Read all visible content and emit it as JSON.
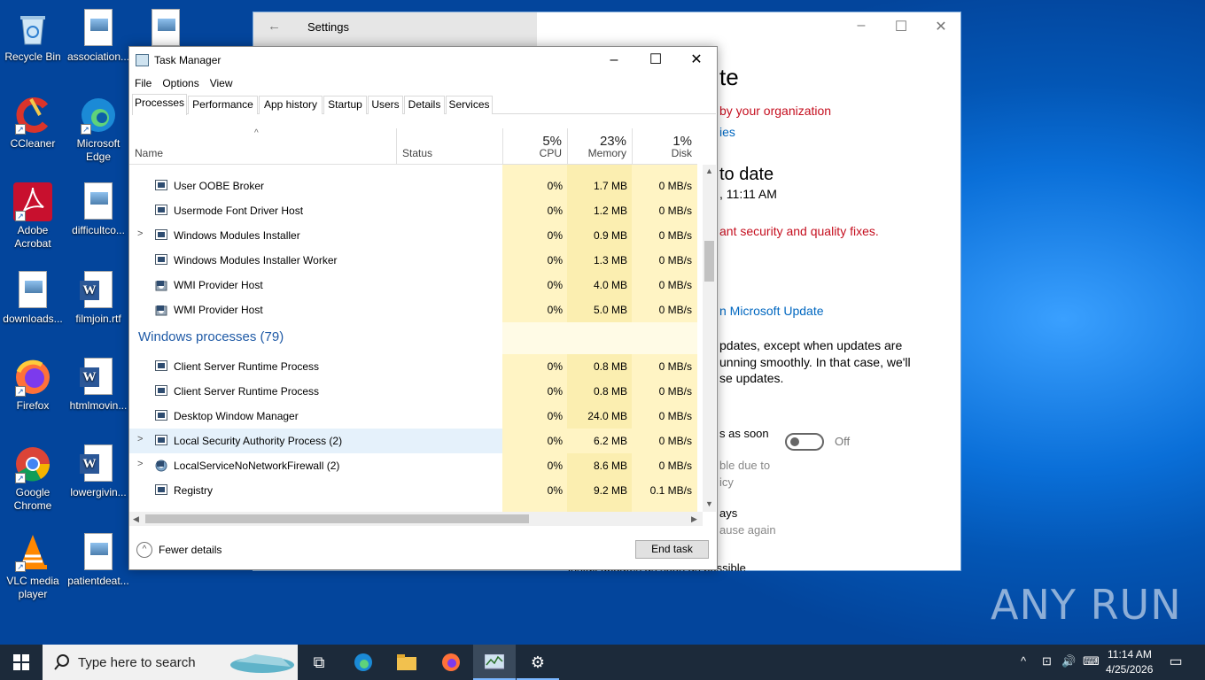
{
  "desktop": {
    "icons": [
      {
        "label": "Recycle Bin"
      },
      {
        "label": "association..."
      },
      {
        "label": "CCleaner"
      },
      {
        "label": "Microsoft Edge"
      },
      {
        "label": "Adobe Acrobat"
      },
      {
        "label": "difficultco..."
      },
      {
        "label": "downloads..."
      },
      {
        "label": "filmjoin.rtf"
      },
      {
        "label": "Firefox"
      },
      {
        "label": "htmlmovin..."
      },
      {
        "label": "Google Chrome"
      },
      {
        "label": "lowergivin..."
      },
      {
        "label": "VLC media player"
      },
      {
        "label": "patientdeat..."
      }
    ]
  },
  "settings": {
    "title": "Settings",
    "heading": "te",
    "org_notice": "by your organization",
    "policies_link": "ies",
    "status_heading": "to date",
    "last_checked": ", 11:11 AM",
    "warning": "ant security and quality fixes.",
    "ms_update_link": "n Microsoft Update",
    "para1": "pdates, except when updates are",
    "para2": "unning smoothly. In that case, we'll",
    "para3": "se updates.",
    "toggle_label": "s as soon",
    "toggle_state": "Off",
    "grey1": "ble due to",
    "grey2": "icy",
    "days": "ays",
    "pause_again": "ause again",
    "cut_bottom": "install updates as soon as possible"
  },
  "taskmanager": {
    "title": "Task Manager",
    "menu": [
      "File",
      "Options",
      "View"
    ],
    "tabs": [
      "Processes",
      "Performance",
      "App history",
      "Startup",
      "Users",
      "Details",
      "Services"
    ],
    "columns": {
      "name": "Name",
      "status": "Status",
      "cpu_pct": "5%",
      "cpu": "CPU",
      "mem_pct": "23%",
      "mem": "Memory",
      "disk_pct": "1%",
      "disk": "Disk"
    },
    "apps_rows": [
      {
        "name": "User OOBE Broker",
        "cpu": "0%",
        "mem": "1.7 MB",
        "disk": "0 MB/s"
      },
      {
        "name": "Usermode Font Driver Host",
        "cpu": "0%",
        "mem": "1.2 MB",
        "disk": "0 MB/s"
      },
      {
        "name": "Windows Modules Installer",
        "cpu": "0%",
        "mem": "0.9 MB",
        "disk": "0 MB/s"
      },
      {
        "name": "Windows Modules Installer Worker",
        "cpu": "0%",
        "mem": "1.3 MB",
        "disk": "0 MB/s"
      },
      {
        "name": "WMI Provider Host",
        "cpu": "0%",
        "mem": "4.0 MB",
        "disk": "0 MB/s"
      },
      {
        "name": "WMI Provider Host",
        "cpu": "0%",
        "mem": "5.0 MB",
        "disk": "0 MB/s"
      }
    ],
    "group_label": "Windows processes (79)",
    "win_rows": [
      {
        "name": "Client Server Runtime Process",
        "cpu": "0%",
        "mem": "0.8 MB",
        "disk": "0 MB/s"
      },
      {
        "name": "Client Server Runtime Process",
        "cpu": "0%",
        "mem": "0.8 MB",
        "disk": "0 MB/s"
      },
      {
        "name": "Desktop Window Manager",
        "cpu": "0%",
        "mem": "24.0 MB",
        "disk": "0 MB/s"
      },
      {
        "name": "Local Security Authority Process (2)",
        "cpu": "0%",
        "mem": "6.2 MB",
        "disk": "0 MB/s"
      },
      {
        "name": "LocalServiceNoNetworkFirewall (2)",
        "cpu": "0%",
        "mem": "8.6 MB",
        "disk": "0 MB/s"
      },
      {
        "name": "Registry",
        "cpu": "0%",
        "mem": "9.2 MB",
        "disk": "0.1 MB/s"
      }
    ],
    "fewer_details": "Fewer details",
    "end_task": "End task"
  },
  "taskbar": {
    "search_placeholder": "Type here to search",
    "time": "11:14 AM",
    "date": "4/25/2026"
  },
  "watermark": "ANY RUN"
}
